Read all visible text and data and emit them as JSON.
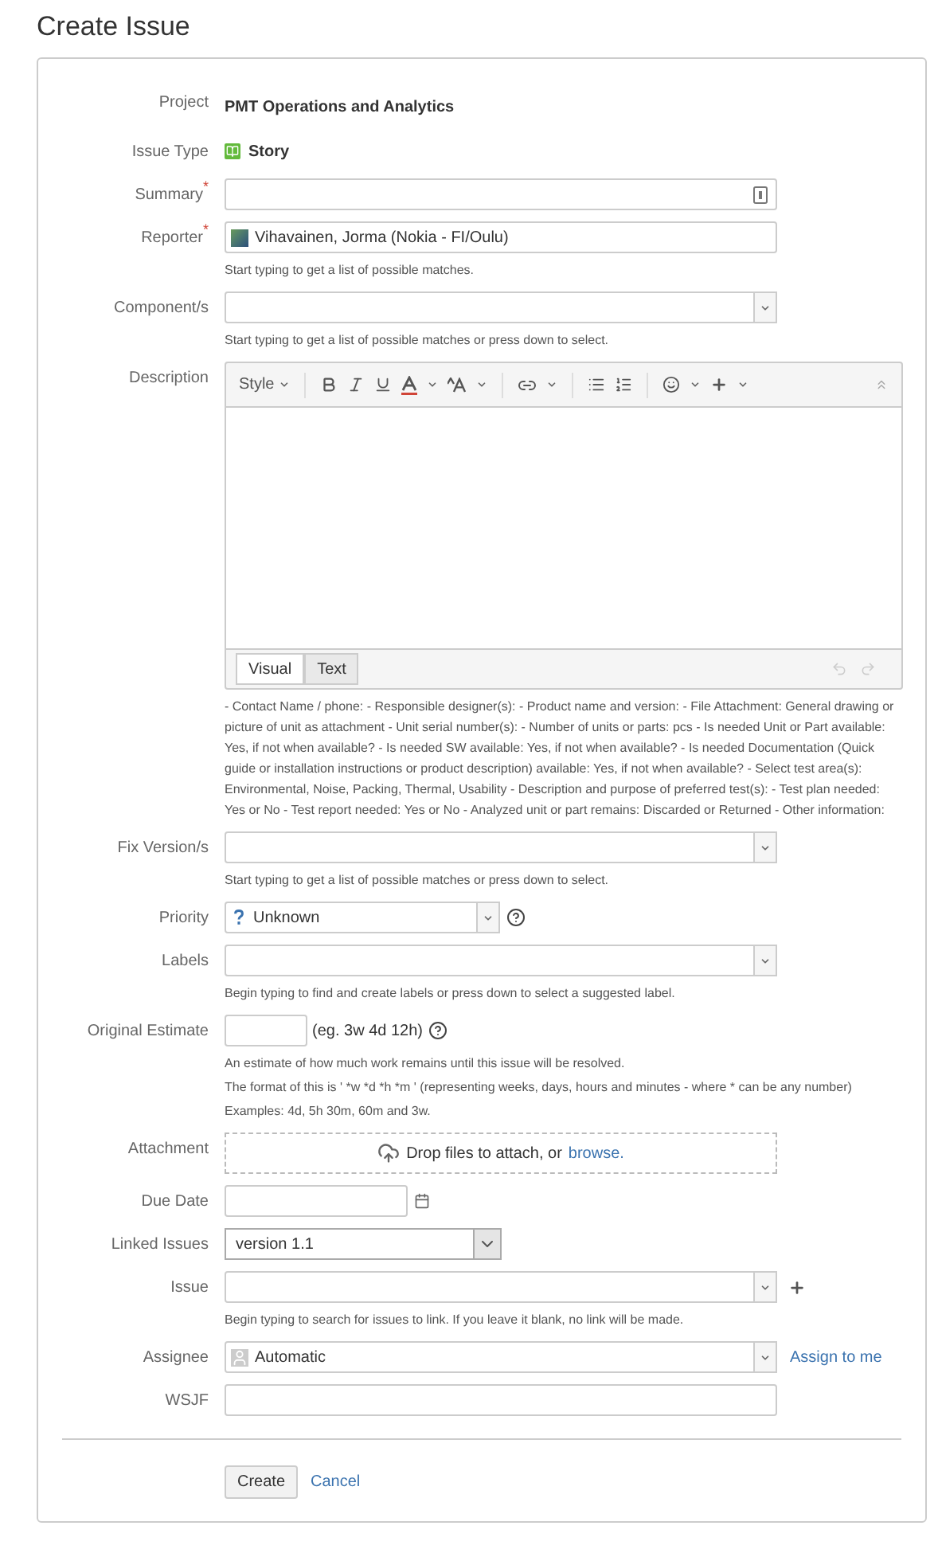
{
  "title": "Create Issue",
  "fields": [
    {
      "kind": "static",
      "label": "Project",
      "value": "PMT Operations and Analytics"
    },
    {
      "kind": "issue_type",
      "label": "Issue Type",
      "value": "Story"
    },
    {
      "kind": "text",
      "label": "Summary",
      "required_mark": "*"
    },
    {
      "kind": "user",
      "label": "Reporter",
      "required_mark": "*",
      "value": "Vihavainen, Jorma (Nokia - FI/Oulu)",
      "help": [
        "Start typing to get a list of possible matches."
      ]
    },
    {
      "kind": "picker",
      "label": "Component/s",
      "help": [
        "Start typing to get a list of possible matches or press down to select."
      ]
    },
    {
      "kind": "editor",
      "label": "Description",
      "style_label": "Style",
      "tabs": [
        {
          "label": "Visual",
          "selected": true
        },
        {
          "label": "Text",
          "selected": false
        }
      ],
      "help": [
        "- Contact Name / phone: - Responsible designer(s): - Product name and version: - File Attachment: General drawing or picture of unit as attachment - Unit serial number(s): - Number of units or parts: pcs - Is needed Unit or Part available: Yes, if not when available? - Is needed SW available: Yes, if not when available? - Is needed Documentation (Quick guide or installation instructions or product description) available: Yes, if not when available? - Select test area(s): Environmental, Noise, Packing, Thermal, Usability - Description and purpose of preferred test(s): - Test plan needed: Yes or No - Test report needed: Yes or No - Analyzed unit or part remains: Discarded or Returned - Other information:"
      ]
    },
    {
      "kind": "picker",
      "label": "Fix Version/s",
      "help": [
        "Start typing to get a list of possible matches or press down to select."
      ]
    },
    {
      "kind": "priority",
      "label": "Priority",
      "value": "Unknown"
    },
    {
      "kind": "picker",
      "label": "Labels",
      "help": [
        "Begin typing to find and create labels or press down to select a suggested label."
      ]
    },
    {
      "kind": "estimate",
      "label": "Original Estimate",
      "hint": "(eg. 3w 4d 12h)",
      "help": [
        "An estimate of how much work remains until this issue will be resolved.",
        "The format of this is ' *w *d *h *m ' (representing weeks, days, hours and minutes - where * can be any number)",
        "Examples: 4d, 5h 30m, 60m and 3w."
      ]
    },
    {
      "kind": "attachment",
      "label": "Attachment",
      "value": "Drop files to attach, or",
      "link": "browse."
    },
    {
      "kind": "date",
      "label": "Due Date"
    },
    {
      "kind": "select",
      "label": "Linked Issues",
      "value": "version 1.1"
    },
    {
      "kind": "issue_picker",
      "label": "Issue",
      "help": [
        "Begin typing to search for issues to link. If you leave it blank, no link will be made."
      ]
    },
    {
      "kind": "assignee",
      "label": "Assignee",
      "value": "Automatic",
      "link": "Assign to me"
    },
    {
      "kind": "text",
      "label": "WSJF"
    }
  ],
  "buttons": {
    "submit": "Create",
    "cancel": "Cancel"
  }
}
